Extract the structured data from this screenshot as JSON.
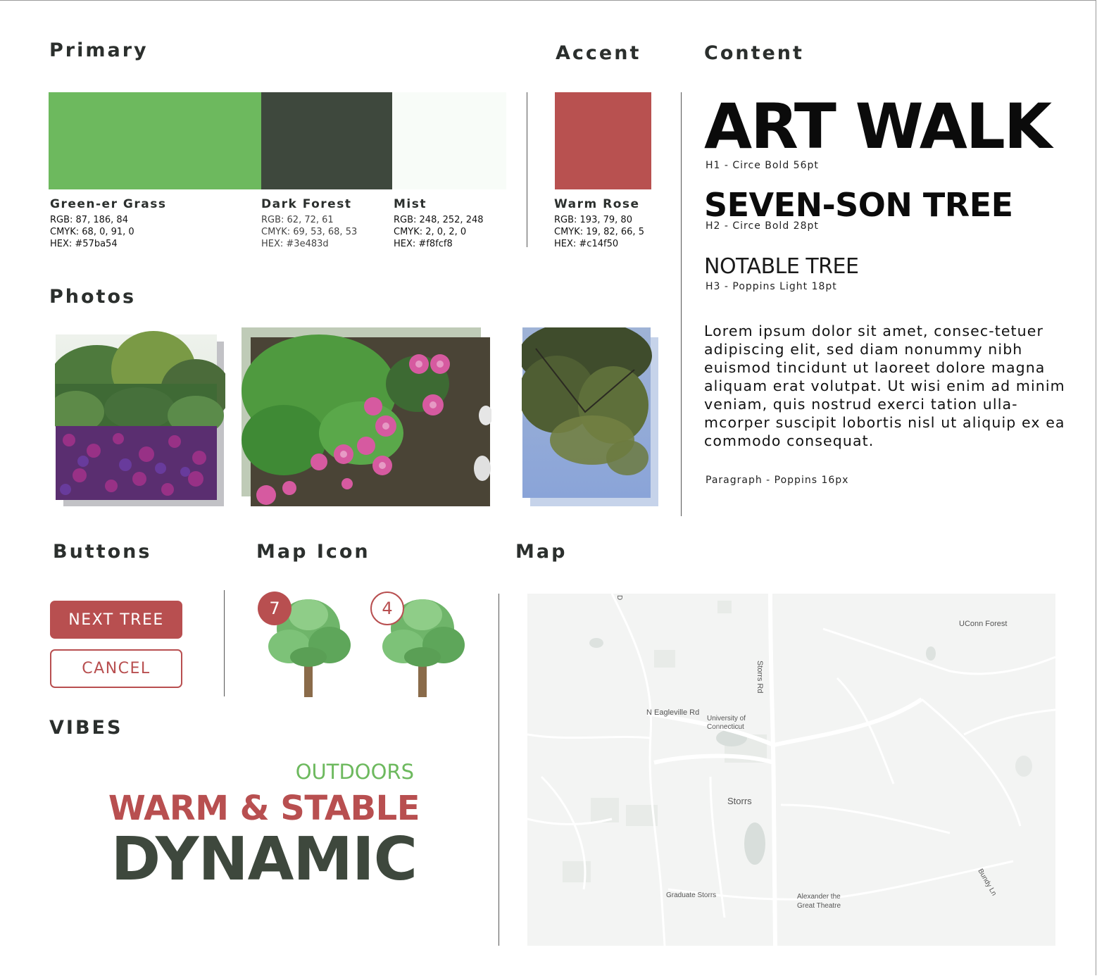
{
  "sections": {
    "primary": "Primary",
    "accent": "Accent",
    "content": "Content",
    "photos": "Photos",
    "buttons": "Buttons",
    "map_icon": "Map Icon",
    "map": "Map",
    "vibes": "VIBES"
  },
  "colors": {
    "green": "#57ba54",
    "dark_forest": "#3e483d",
    "mist": "#f8fcf8",
    "warm_rose": "#c14f50"
  },
  "swatches": [
    {
      "name": "Green-er Grass",
      "rgb": "RGB: 87, 186, 84",
      "cmyk": "CMYK: 68, 0, 91, 0",
      "hex": "HEX: #57ba54"
    },
    {
      "name": "Dark Forest",
      "rgb": "RGB: 62, 72, 61",
      "cmyk": "CMYK: 69, 53, 68, 53",
      "hex": "HEX: #3e483d"
    },
    {
      "name": "Mist",
      "rgb": "RGB: 248, 252, 248",
      "cmyk": "CMYK: 2, 0, 2, 0",
      "hex": "HEX: #f8fcf8"
    }
  ],
  "accent_swatch": {
    "name": "Warm Rose",
    "rgb": "RGB: 193, 79, 80",
    "cmyk": "CMYK: 19, 82, 66, 5",
    "hex": "HEX: #c14f50"
  },
  "typography": {
    "h1": "ART WALK",
    "h1_caption": "H1 - Circe Bold 56pt",
    "h2": "SEVEN-SON TREE",
    "h2_caption": "H2 - Circe Bold 28pt",
    "h3": "NOTABLE TREE",
    "h3_caption": "H3 - Poppins Light 18pt",
    "paragraph": "Lorem ipsum dolor sit amet, consec-tetuer adipiscing elit, sed diam nonummy nibh euismod tincidunt ut laoreet dolore magna aliquam erat volutpat. Ut wisi enim ad minim veniam, quis nostrud exerci tation ulla-mcorper suscipit lobortis nisl ut aliquip ex ea commodo consequat.",
    "paragraph_caption": "Paragraph - Poppins 16px"
  },
  "buttons": {
    "next": "NEXT TREE",
    "cancel": "CANCEL"
  },
  "map_icons": [
    {
      "count": "7",
      "style": "filled"
    },
    {
      "count": "4",
      "style": "outline"
    }
  ],
  "vibes": {
    "line1": "OUTDOORS",
    "line2": "WARM & STABLE",
    "line3": "DYNAMIC"
  },
  "map_labels": {
    "forest": "UConn Forest",
    "storrs_rd": "Storrs Rd",
    "eagleville": "N Eagleville Rd",
    "uconn_1": "University of",
    "uconn_2": "Connecticut",
    "storrs": "Storrs",
    "graduate": "Graduate Storrs",
    "theatre_1": "Alexander the",
    "theatre_2": "Great Theatre",
    "bundy": "Bundy Ln",
    "d": "D"
  }
}
